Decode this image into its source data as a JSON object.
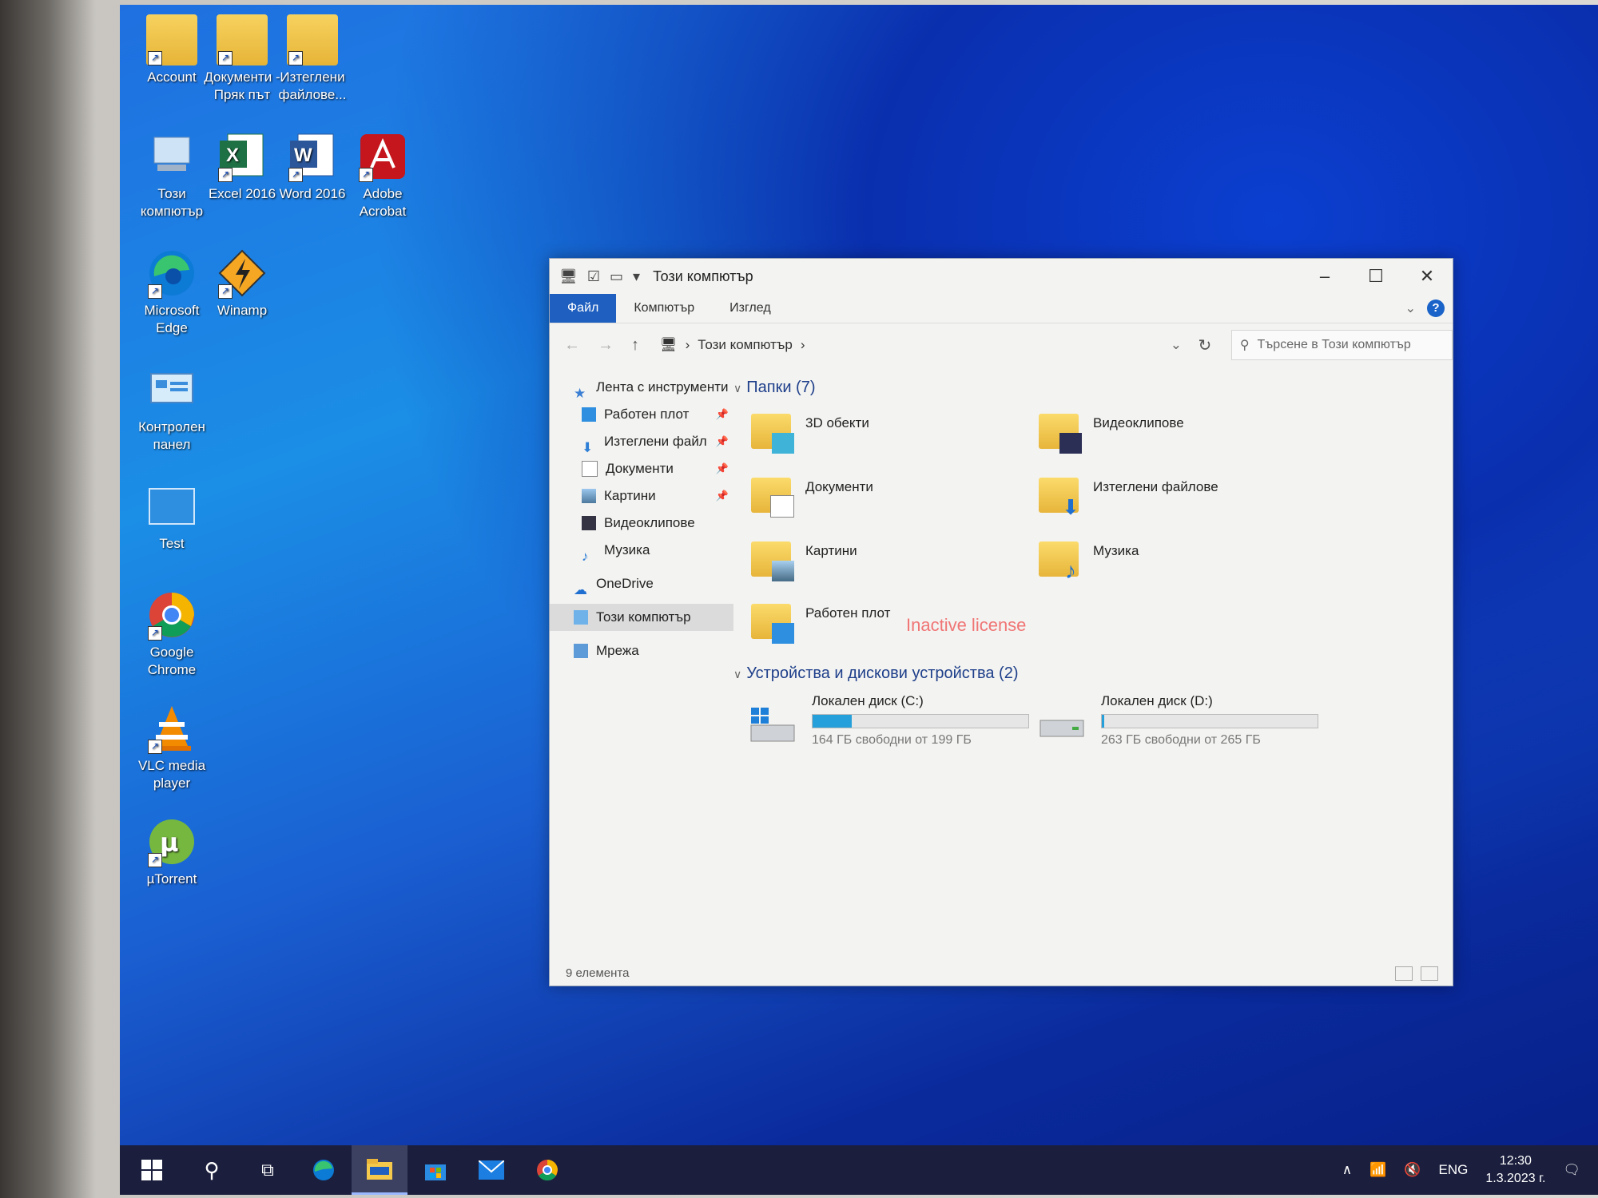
{
  "desktop": {
    "icons": [
      {
        "label": "Account"
      },
      {
        "label": "Документи - Пряк път"
      },
      {
        "label": "Изтеглени файлове..."
      },
      {
        "label": "Този компютър"
      },
      {
        "label": "Excel 2016"
      },
      {
        "label": "Word 2016"
      },
      {
        "label": "Adobe Acrobat"
      },
      {
        "label": "Microsoft Edge"
      },
      {
        "label": "Winamp"
      },
      {
        "label": "Контролен панел"
      },
      {
        "label": "Test"
      },
      {
        "label": "Google Chrome"
      },
      {
        "label": "VLC media player"
      },
      {
        "label": "µTorrent"
      }
    ]
  },
  "explorer": {
    "title": "Този компютър",
    "ribbon_tabs": [
      "Файл",
      "Компютър",
      "Изглед"
    ],
    "address": "Този компютър",
    "search_placeholder": "Търсене в Този компютър",
    "nav": [
      {
        "label": "Лента с инструменти"
      },
      {
        "label": "Работен плот",
        "pinned": true
      },
      {
        "label": "Изтеглени файл",
        "pinned": true
      },
      {
        "label": "Документи",
        "pinned": true
      },
      {
        "label": "Картини",
        "pinned": true
      },
      {
        "label": "Видеоклипове"
      },
      {
        "label": "Музика"
      },
      {
        "label": "OneDrive"
      },
      {
        "label": "Този компютър",
        "selected": true
      },
      {
        "label": "Мрежа"
      }
    ],
    "folders_header": "Папки (7)",
    "folders": [
      {
        "label": "3D обекти",
        "icon": "3d-objects-icon"
      },
      {
        "label": "Видеоклипове",
        "icon": "video-icon"
      },
      {
        "label": "Документи",
        "icon": "documents-icon"
      },
      {
        "label": "Изтеглени файлове",
        "icon": "download-icon"
      },
      {
        "label": "Картини",
        "icon": "pictures-icon"
      },
      {
        "label": "Музика",
        "icon": "music-icon"
      },
      {
        "label": "Работен плот",
        "icon": "desktop-icon"
      }
    ],
    "drives_header": "Устройства и дискови устройства (2)",
    "drives": [
      {
        "label": "Локален диск (C:)",
        "free": "164 ГБ свободни от 199 ГБ",
        "used_fraction": 0.18
      },
      {
        "label": "Локален диск (D:)",
        "free": "263 ГБ свободни от 265 ГБ",
        "used_fraction": 0.01
      }
    ],
    "watermark": "Inactive license",
    "status": "9 елемента"
  },
  "taskbar": {
    "lang": "ENG",
    "time": "12:30",
    "date": "1.3.2023 г."
  },
  "colors": {
    "accent": "#1f5fbf",
    "drive_bar": "#26a0da",
    "taskbar": "#1b1f3d"
  }
}
